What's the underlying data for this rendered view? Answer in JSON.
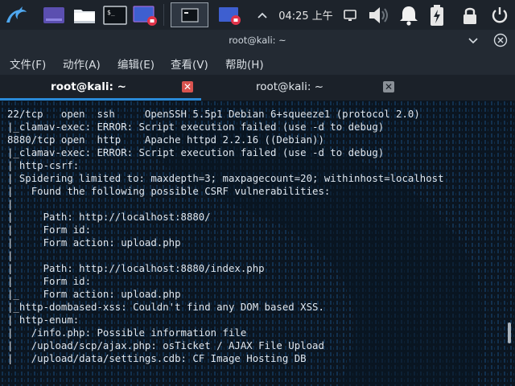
{
  "panel": {
    "clock": "04:25 上午",
    "colors": {
      "panel_bg": "#1d232b",
      "accent_red": "#d9534f",
      "accent_blue": "#2a8ad7"
    },
    "icons": [
      "kali-dragon-icon",
      "workspace-icon",
      "file-manager-icon",
      "terminal-icon",
      "screen-recorder-icon",
      "terminal-task-icon",
      "screen-recorder-task-icon",
      "chevron-up-icon",
      "display-icon",
      "volume-icon",
      "notification-bell-icon",
      "battery-charging-icon",
      "lock-icon",
      "power-icon"
    ]
  },
  "window": {
    "title": "root@kali: ~",
    "menu": [
      "文件(F)",
      "动作(A)",
      "编辑(E)",
      "查看(V)",
      "帮助(H)"
    ],
    "tabs": [
      {
        "label": "root@kali: ~",
        "active": true
      },
      {
        "label": "root@kali: ~",
        "active": false
      }
    ],
    "tab_close_glyph": "✕"
  },
  "terminal": {
    "lines": [
      "22/tcp   open  ssh     OpenSSH 5.5p1 Debian 6+squeeze1 (protocol 2.0)",
      "|_clamav-exec: ERROR: Script execution failed (use -d to debug)",
      "8880/tcp open  http    Apache httpd 2.2.16 ((Debian))",
      "|_clamav-exec: ERROR: Script execution failed (use -d to debug)",
      "| http-csrf:",
      "| Spidering limited to: maxdepth=3; maxpagecount=20; withinhost=localhost",
      "|   Found the following possible CSRF vulnerabilities:",
      "|",
      "|     Path: http://localhost:8880/",
      "|     Form id:",
      "|     Form action: upload.php",
      "|",
      "|     Path: http://localhost:8880/index.php",
      "|     Form id:",
      "|_    Form action: upload.php",
      "|_http-dombased-xss: Couldn't find any DOM based XSS.",
      "| http-enum:",
      "|   /info.php: Possible information file",
      "|   /upload/scp/ajax.php: osTicket / AJAX File Upload",
      "|   /upload/data/settings.cdb: CF Image Hosting DB"
    ]
  }
}
